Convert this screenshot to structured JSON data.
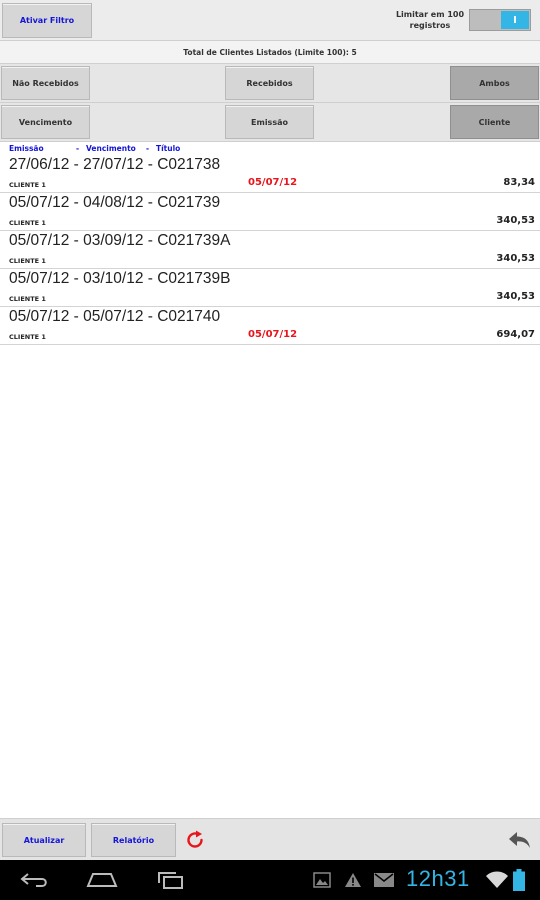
{
  "toolbar": {
    "filter_label": "Ativar Filtro",
    "limit_label": "Limitar em 100 registros",
    "toggle_state": "I"
  },
  "summary": {
    "total_text": "Total de Clientes Listados (Limite 100): 5"
  },
  "status_filter": {
    "options": [
      "Não Recebidos",
      "Recebidos",
      "Ambos"
    ],
    "selected": "Ambos"
  },
  "sort_filter": {
    "options": [
      "Vencimento",
      "Emissão",
      "Cliente"
    ],
    "selected": "Cliente"
  },
  "sort_header": {
    "col1": "Emissão",
    "col2": "Vencimento",
    "col3": "Título"
  },
  "items": [
    {
      "line": "27/06/12 - 27/07/12 - C021738",
      "client": "CLIENTE 1",
      "date": "05/07/12",
      "amount": "83,34"
    },
    {
      "line": "05/07/12 - 04/08/12 - C021739",
      "client": "CLIENTE 1",
      "date": "",
      "amount": "340,53"
    },
    {
      "line": "05/07/12 - 03/09/12 - C021739A",
      "client": "CLIENTE 1",
      "date": "",
      "amount": "340,53"
    },
    {
      "line": "05/07/12 - 03/10/12 - C021739B",
      "client": "CLIENTE 1",
      "date": "",
      "amount": "340,53"
    },
    {
      "line": "05/07/12 - 05/07/12 - C021740",
      "client": "CLIENTE 1",
      "date": "05/07/12",
      "amount": "694,07"
    }
  ],
  "bottom": {
    "update_label": "Atualizar",
    "report_label": "Relatório"
  },
  "system_bar": {
    "clock": "12h31"
  },
  "colors": {
    "accent": "#33b5e5",
    "link_blue": "#1515d8",
    "date_red": "#e8151b",
    "selected_button": "#a9a9a9"
  }
}
